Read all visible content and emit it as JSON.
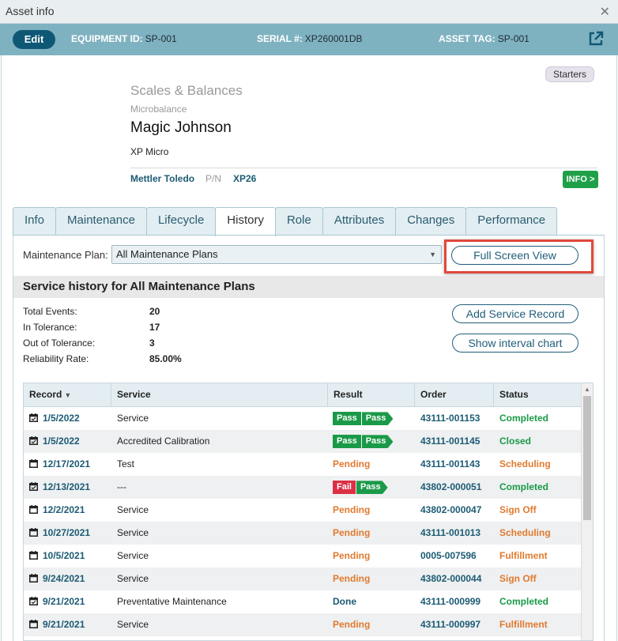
{
  "window": {
    "title": "Asset info"
  },
  "header": {
    "edit_label": "Edit",
    "equipment_id_label": "EQUIPMENT ID:",
    "equipment_id": "SP-001",
    "serial_label": "SERIAL #:",
    "serial": "XP260001DB",
    "asset_tag_label": "ASSET TAG:",
    "asset_tag": "SP-001"
  },
  "asset": {
    "badge": "Starters",
    "category": "Scales & Balances",
    "subcategory": "Microbalance",
    "name": "Magic Johnson",
    "model": "XP Micro",
    "manufacturer": "Mettler Toledo",
    "pn_label": "P/N",
    "part_number": "XP26",
    "info_label": "INFO >"
  },
  "tabs": [
    "Info",
    "Maintenance",
    "Lifecycle",
    "History",
    "Role",
    "Attributes",
    "Changes",
    "Performance"
  ],
  "active_tab": "History",
  "history": {
    "plan_label": "Maintenance Plan:",
    "plan_value": "All Maintenance Plans",
    "full_screen_label": "Full Screen View",
    "section_title": "Service history for All Maintenance Plans",
    "add_record_label": "Add Service Record",
    "interval_chart_label": "Show interval chart",
    "stats": [
      {
        "label": "Total Events:",
        "value": "20"
      },
      {
        "label": "In Tolerance:",
        "value": "17"
      },
      {
        "label": "Out of Tolerance:",
        "value": "3"
      },
      {
        "label": "Reliability Rate:",
        "value": "85.00%"
      }
    ],
    "columns": [
      "Record",
      "Service",
      "Result",
      "Order",
      "Status"
    ],
    "rows": [
      {
        "record": "1/5/2022",
        "checked": true,
        "service": "Service",
        "result": [
          "Pass",
          "Pass"
        ],
        "order": "43111-001153",
        "status": "Completed"
      },
      {
        "record": "1/5/2022",
        "checked": true,
        "service": "Accredited Calibration",
        "result": [
          "Pass",
          "Pass"
        ],
        "order": "43111-001145",
        "status": "Closed"
      },
      {
        "record": "12/17/2021",
        "checked": false,
        "service": "Test",
        "result": "Pending",
        "order": "43111-001143",
        "status": "Scheduling"
      },
      {
        "record": "12/13/2021",
        "checked": true,
        "service": "---",
        "result": [
          "Fail",
          "Pass"
        ],
        "order": "43802-000051",
        "status": "Completed"
      },
      {
        "record": "12/2/2021",
        "checked": false,
        "service": "Service",
        "result": "Pending",
        "order": "43802-000047",
        "status": "Sign Off"
      },
      {
        "record": "10/27/2021",
        "checked": false,
        "service": "Service",
        "result": "Pending",
        "order": "43111-001013",
        "status": "Scheduling"
      },
      {
        "record": "10/5/2021",
        "checked": false,
        "service": "Service",
        "result": "Pending",
        "order": "0005-007596",
        "status": "Fulfillment"
      },
      {
        "record": "9/24/2021",
        "checked": false,
        "service": "Service",
        "result": "Pending",
        "order": "43802-000044",
        "status": "Sign Off"
      },
      {
        "record": "9/21/2021",
        "checked": true,
        "service": "Preventative Maintenance",
        "result": "Done",
        "order": "43111-000999",
        "status": "Completed"
      },
      {
        "record": "9/21/2021",
        "checked": false,
        "service": "Service",
        "result": "Pending",
        "order": "43111-000997",
        "status": "Fulfillment"
      }
    ]
  },
  "colors": {
    "header_bar": "#7fb2c1",
    "edit_button": "#0f5875",
    "link": "#1c5b74",
    "pass": "#1a9a48",
    "fail": "#dc2f45",
    "pending": "#e07a2f",
    "done": "#1c5b74",
    "completed": "#1a9a48",
    "closed": "#1a9a48",
    "scheduling": "#e07a2f",
    "sign_off": "#e07a2f",
    "fulfillment": "#e07a2f",
    "highlight": "#e0483b"
  }
}
